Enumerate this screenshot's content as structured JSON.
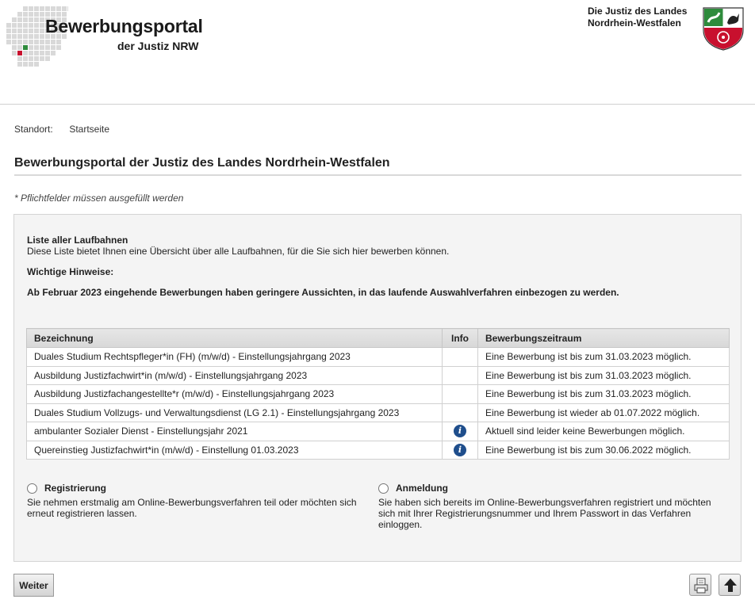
{
  "header": {
    "title": "Bewerbungsportal",
    "subtitle": "der Justiz NRW",
    "state_line1": "Die Justiz des Landes",
    "state_line2": "Nordrhein-Westfalen",
    "logo_icon": "nrw-map-grid-logo",
    "crest_icon": "nrw-coat-of-arms-icon",
    "colors": {
      "green": "#2e8b3c",
      "red": "#c8102e"
    }
  },
  "breadcrumb": {
    "label": "Standort:",
    "current": "Startseite"
  },
  "page_title": "Bewerbungsportal der Justiz des Landes Nordrhein-Westfalen",
  "required_note": "* Pflichtfelder müssen ausgefüllt werden",
  "intro": {
    "heading": "Liste aller Laufbahnen",
    "text": "Diese Liste bietet Ihnen eine Übersicht über alle Laufbahnen, für die Sie sich hier bewerben können.",
    "hint_heading": "Wichtige Hinweise:",
    "hint_text": "Ab Februar 2023 eingehende Bewerbungen haben geringere Aussichten, in das laufende Auswahlverfahren einbezogen zu werden."
  },
  "table": {
    "columns": [
      "Bezeichnung",
      "Info",
      "Bewerbungszeitraum"
    ],
    "rows": [
      {
        "name": "Duales Studium Rechtspfleger*in (FH) (m/w/d) - Einstellungsjahrgang 2023",
        "info": false,
        "period": "Eine Bewerbung ist bis zum 31.03.2023 möglich."
      },
      {
        "name": "Ausbildung Justizfachwirt*in (m/w/d) - Einstellungsjahrgang 2023",
        "info": false,
        "period": "Eine Bewerbung ist bis zum 31.03.2023 möglich."
      },
      {
        "name": "Ausbildung Justizfachangestellte*r (m/w/d) - Einstellungsjahrgang 2023",
        "info": false,
        "period": "Eine Bewerbung ist bis zum 31.03.2023 möglich."
      },
      {
        "name": "Duales Studium Vollzugs- und Verwaltungsdienst (LG 2.1) - Einstellungsjahrgang 2023",
        "info": false,
        "period": "Eine Bewerbung ist wieder ab 01.07.2022 möglich."
      },
      {
        "name": "ambulanter Sozialer Dienst - Einstellungsjahr 2021",
        "info": true,
        "period": "Aktuell sind leider keine Bewerbungen möglich."
      },
      {
        "name": "Quereinstieg Justizfachwirt*in (m/w/d) - Einstellung 01.03.2023",
        "info": true,
        "period": "Eine Bewerbung ist bis zum 30.06.2022 möglich."
      }
    ],
    "info_icon_glyph": "i"
  },
  "options": {
    "register": {
      "title": "Registrierung",
      "desc": "Sie nehmen erstmalig am Online-Bewerbungsverfahren teil oder möchten sich erneut registrieren lassen."
    },
    "login": {
      "title": "Anmeldung",
      "desc": "Sie haben sich bereits im Online-Bewerbungsverfahren registriert und möchten sich mit Ihrer Registrierungsnummer und Ihrem Passwort in das Verfahren einloggen."
    }
  },
  "buttons": {
    "next": "Weiter",
    "print_icon": "print-icon",
    "top_icon": "arrow-up-icon"
  }
}
